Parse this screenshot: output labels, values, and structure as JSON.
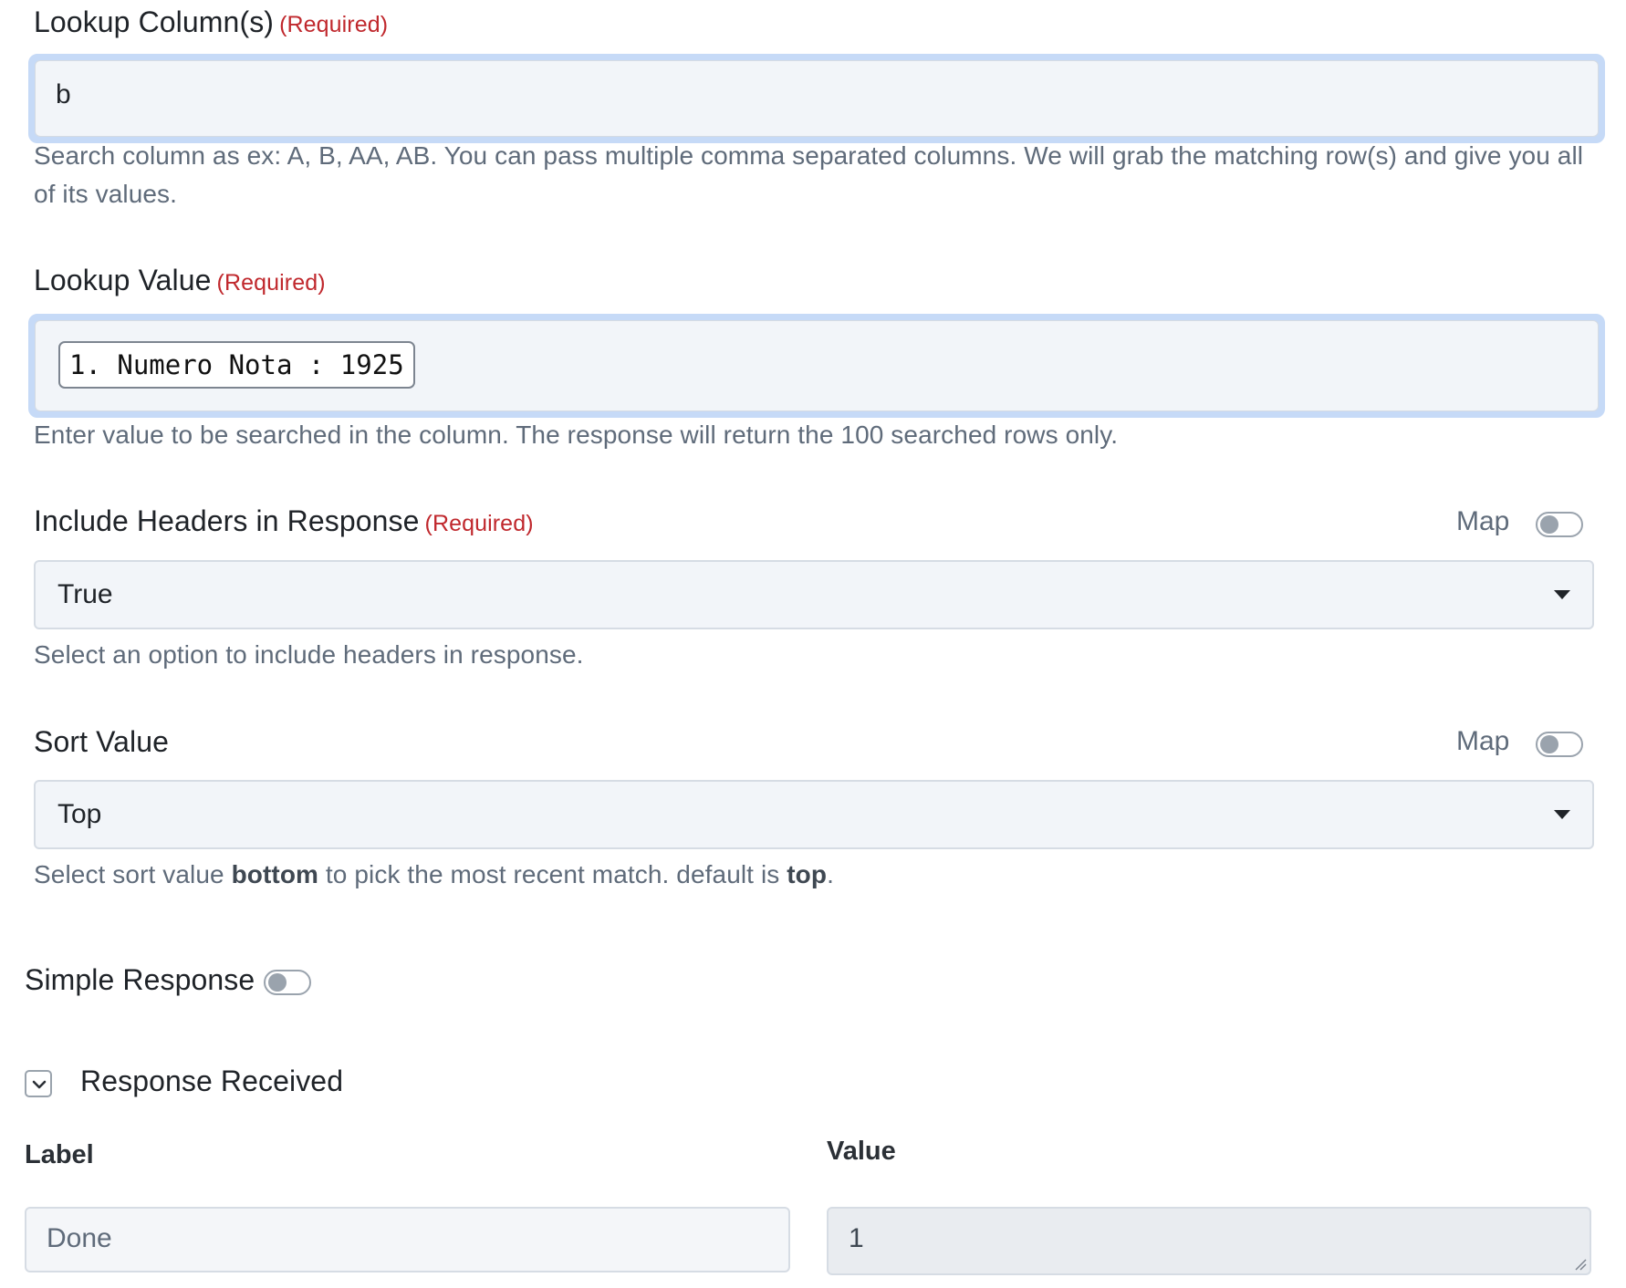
{
  "lookup_columns": {
    "label": "Lookup Column(s)",
    "required": "(Required)",
    "value": "b",
    "help": "Search column as ex: A, B, AA, AB. You can pass multiple comma separated columns. We will grab the matching row(s) and give you all of its values."
  },
  "lookup_value": {
    "label": "Lookup Value",
    "required": "(Required)",
    "chip": "1. Numero Nota : 1925",
    "help": "Enter value to be searched in the column. The response will return the 100 searched rows only."
  },
  "include_headers": {
    "label": "Include Headers in Response",
    "required": "(Required)",
    "map_label": "Map",
    "map_on": false,
    "selected": "True",
    "help": "Select an option to include headers in response."
  },
  "sort_value": {
    "label": "Sort Value",
    "map_label": "Map",
    "map_on": false,
    "selected": "Top",
    "help_pre": "Select sort value ",
    "help_bold1": "bottom",
    "help_mid": " to pick the most recent match. default is ",
    "help_bold2": "top",
    "help_end": "."
  },
  "simple_response": {
    "label": "Simple Response",
    "on": false
  },
  "response_received": {
    "title": "Response Received",
    "expanded": true,
    "label_header": "Label",
    "value_header": "Value",
    "rows": [
      {
        "label": "Done",
        "value": "1"
      }
    ]
  },
  "colors": {
    "required": "#c0282d",
    "focus_ring": "#c6daf7",
    "input_bg": "#f2f5f9",
    "help_text": "#5f6b7a"
  },
  "icons": {
    "select_caret": "caret-down-icon",
    "collapse": "chevron-down-icon",
    "resize": "resize-grip-icon"
  }
}
